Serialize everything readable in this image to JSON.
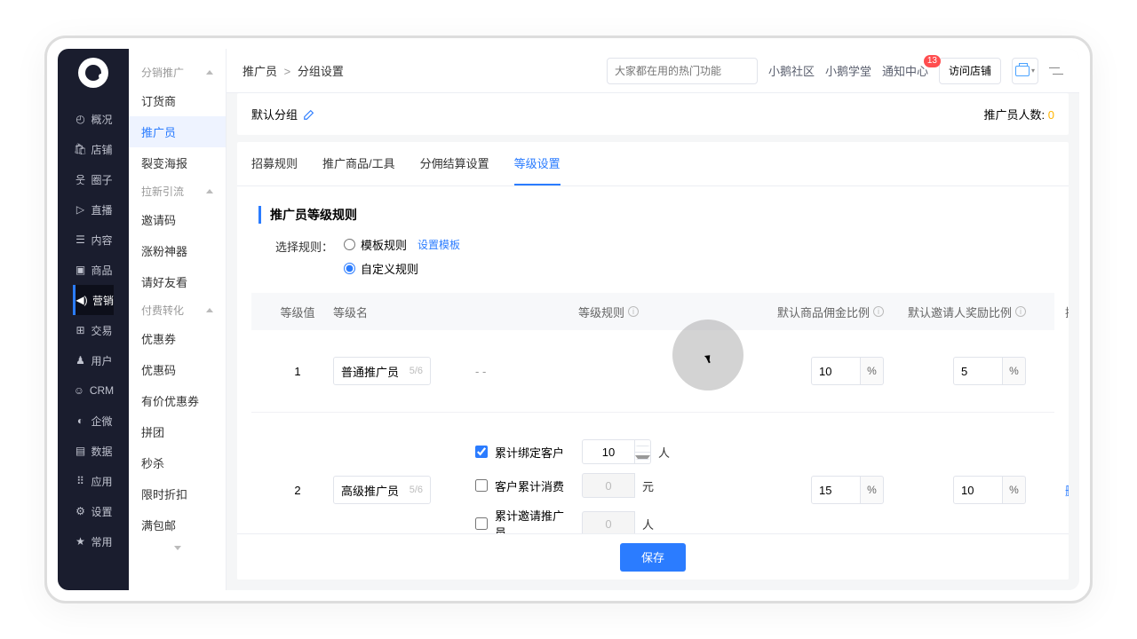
{
  "nav": {
    "items": [
      {
        "icon": "clock",
        "label": "概况"
      },
      {
        "icon": "bag",
        "label": "店铺"
      },
      {
        "icon": "people",
        "label": "圈子"
      },
      {
        "icon": "video",
        "label": "直播"
      },
      {
        "icon": "doc",
        "label": "内容"
      },
      {
        "icon": "box",
        "label": "商品"
      },
      {
        "icon": "speaker",
        "label": "营销",
        "active": true
      },
      {
        "icon": "cart",
        "label": "交易"
      },
      {
        "icon": "user",
        "label": "用户"
      },
      {
        "icon": "crm",
        "label": "CRM"
      },
      {
        "icon": "wechat",
        "label": "企微"
      },
      {
        "icon": "data",
        "label": "数据"
      },
      {
        "icon": "apps",
        "label": "应用"
      },
      {
        "icon": "gear",
        "label": "设置"
      },
      {
        "icon": "star",
        "label": "常用"
      }
    ]
  },
  "sub": {
    "groups": [
      {
        "title": "分销推广",
        "items": [
          "订货商",
          "推广员",
          "裂变海报"
        ],
        "activeIndex": 1
      },
      {
        "title": "拉新引流",
        "items": [
          "邀请码",
          "涨粉神器",
          "请好友看"
        ]
      },
      {
        "title": "付费转化",
        "items": [
          "优惠券",
          "优惠码",
          "有价优惠券",
          "拼团",
          "秒杀",
          "限时折扣",
          "满包邮"
        ]
      }
    ]
  },
  "topbar": {
    "breadcrumb1": "推广员",
    "sep": ">",
    "breadcrumb2": "分组设置",
    "searchPlaceholder": "大家都在用的热门功能",
    "links": [
      "小鹅社区",
      "小鹅学堂"
    ],
    "notify": "通知中心",
    "notifyCount": "13",
    "shopBtn": "访问店铺"
  },
  "group": {
    "name": "默认分组",
    "countLabel": "推广员人数:",
    "countValue": "0"
  },
  "tabs": [
    "招募规则",
    "推广商品/工具",
    "分佣结算设置",
    "等级设置"
  ],
  "activeTab": 3,
  "section": {
    "title": "推广员等级规则",
    "ruleLabel": "选择规则：",
    "radios": {
      "template": "模板规则",
      "templateLink": "设置模板",
      "custom": "自定义规则"
    }
  },
  "tableHead": {
    "levelVal": "等级值",
    "levelName": "等级名",
    "rule": "等级规则",
    "comm": "默认商品佣金比例",
    "invite": "默认邀请人奖励比例",
    "op": "操作"
  },
  "rows": [
    {
      "level": "1",
      "name": "普通推广员",
      "nameCount": "5/6",
      "ruleText": "- -",
      "comm": "10",
      "invite": "5",
      "op": "- -"
    },
    {
      "level": "2",
      "name": "高级推广员",
      "nameCount": "5/6",
      "comm": "15",
      "invite": "10",
      "opDelete": "删除",
      "rules": [
        {
          "label": "累计绑定客户",
          "checked": true,
          "value": "10",
          "unit": "人",
          "spinner": true
        },
        {
          "label": "客户累计消费",
          "checked": false,
          "value": "0",
          "unit": "元",
          "disabled": true
        },
        {
          "label": "累计邀请推广员",
          "checked": false,
          "value": "0",
          "unit": "人",
          "disabled": true
        }
      ]
    }
  ],
  "save": "保存",
  "pct": "%"
}
